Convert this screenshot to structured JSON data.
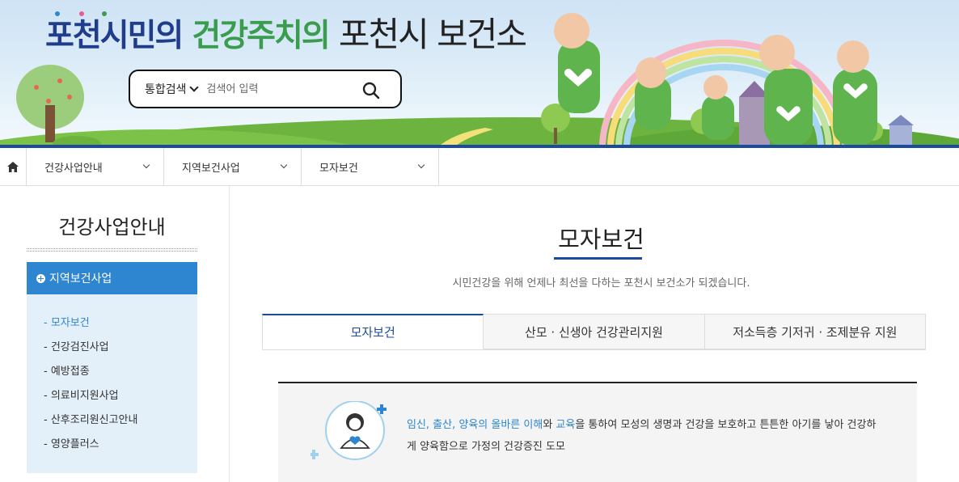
{
  "header": {
    "logo": {
      "part1": "포천시민의",
      "part2": "건강주치의",
      "part3": "포천시 보건소"
    },
    "search": {
      "category": "통합검색",
      "placeholder": "검색어 입력"
    }
  },
  "nav": {
    "items": [
      {
        "label": "건강사업안내"
      },
      {
        "label": "지역보건사업"
      },
      {
        "label": "모자보건"
      }
    ]
  },
  "sidebar": {
    "title": "건강사업안내",
    "active_section": "지역보건사업",
    "items": [
      {
        "label": "- 모자보건",
        "active": true
      },
      {
        "label": "- 건강검진사업"
      },
      {
        "label": "- 예방접종"
      },
      {
        "label": "- 의료비지원사업"
      },
      {
        "label": "- 산후조리원신고안내"
      },
      {
        "label": "- 영양플러스"
      }
    ]
  },
  "main": {
    "title": "모자보건",
    "subtitle": "시민건강을 위해 언제나 최선을 다하는 포천시 보건소가 되겠습니다.",
    "tabs": [
      {
        "label": "모자보건",
        "active": true
      },
      {
        "label": "산모 · 신생아 건강관리지원"
      },
      {
        "label": "저소득층 기저귀 · 조제분유 지원"
      }
    ],
    "info": {
      "hl_1": "임신, 출산, 양육의 올바른 이해",
      "connector_1": "와 ",
      "hl_2": "교육",
      "rest": "을 통하여 모성의 생명과 건강을 보호하고 튼튼한 아기를 낳아 건강하게 양육함으로 가정의 건강증진 도모"
    }
  },
  "colors": {
    "navy": "#1c4a9c",
    "accent_blue": "#2e86d0",
    "green": "#3a9d4d"
  }
}
